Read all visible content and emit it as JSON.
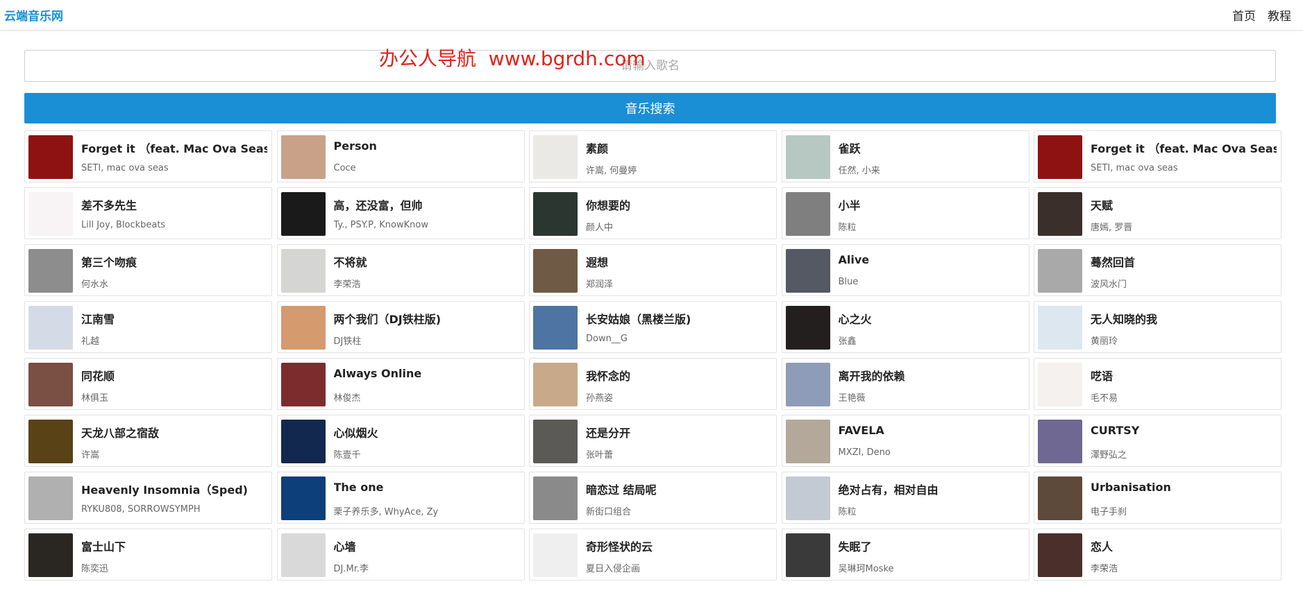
{
  "brand": "云端音乐网",
  "nav": [
    {
      "label": "首页"
    },
    {
      "label": "教程"
    }
  ],
  "search": {
    "placeholder": "请输入歌名",
    "watermark": "办公人导航  www.bgrdh.com",
    "button_label": "音乐搜索"
  },
  "songs": [
    {
      "title": "Forget it （feat. Mac Ova Seas)",
      "artist": "SETI, mac ova seas",
      "cover": "#8f1212"
    },
    {
      "title": "Person",
      "artist": "Coce",
      "cover": "#c9a189"
    },
    {
      "title": "素颜",
      "artist": "许嵩, 何曼婷",
      "cover": "#ebe9e6"
    },
    {
      "title": "雀跃",
      "artist": "任然, 小来",
      "cover": "#b7c8c2"
    },
    {
      "title": "Forget it （feat. Mac Ova Seas)",
      "artist": "SETI, mac ova seas",
      "cover": "#8f1212"
    },
    {
      "title": "差不多先生",
      "artist": "Lill Joy, Blockbeats",
      "cover": "#f8f4f5"
    },
    {
      "title": "高，还没富，但帅",
      "artist": "Ty., PSY.P, KnowKnow",
      "cover": "#1a1a1a"
    },
    {
      "title": "你想要的",
      "artist": "颜人中",
      "cover": "#2b3630"
    },
    {
      "title": "小半",
      "artist": "陈粒",
      "cover": "#7f7f7f"
    },
    {
      "title": "天赋",
      "artist": "唐嫣, 罗晋",
      "cover": "#3b2f2b"
    },
    {
      "title": "第三个吻痕",
      "artist": "何水水",
      "cover": "#8d8d8d"
    },
    {
      "title": "不将就",
      "artist": "李荣浩",
      "cover": "#d5d6d3"
    },
    {
      "title": "遐想",
      "artist": "郑润泽",
      "cover": "#6e5a45"
    },
    {
      "title": "Alive",
      "artist": "Blue",
      "cover": "#545963"
    },
    {
      "title": "蓦然回首",
      "artist": "波风水门",
      "cover": "#a9a9a9"
    },
    {
      "title": "江南雪",
      "artist": "礼越",
      "cover": "#d5dbe6"
    },
    {
      "title": "两个我们（DJ铁柱版)",
      "artist": "DJ铁柱",
      "cover": "#d59a6e"
    },
    {
      "title": "长安姑娘（黑楼兰版)",
      "artist": "Down__G",
      "cover": "#4d74a3"
    },
    {
      "title": "心之火",
      "artist": "张鑫",
      "cover": "#231f1e"
    },
    {
      "title": "无人知晓的我",
      "artist": "黄丽玲",
      "cover": "#dce7ef"
    },
    {
      "title": "同花顺",
      "artist": "林俱玉",
      "cover": "#7a4f44"
    },
    {
      "title": "Always Online",
      "artist": "林俊杰",
      "cover": "#7c2c2c"
    },
    {
      "title": "我怀念的",
      "artist": "孙燕姿",
      "cover": "#c8a98a"
    },
    {
      "title": "离开我的依赖",
      "artist": "王艳薇",
      "cover": "#8e9cb7"
    },
    {
      "title": "呓语",
      "artist": "毛不易",
      "cover": "#f4f1ee"
    },
    {
      "title": "天龙八部之宿敌",
      "artist": "许嵩",
      "cover": "#5a4217"
    },
    {
      "title": "心似烟火",
      "artist": "陈壹千",
      "cover": "#12284f"
    },
    {
      "title": "还是分开",
      "artist": "张叶蕾",
      "cover": "#5c5a56"
    },
    {
      "title": "FAVELA",
      "artist": "MXZI, Deno",
      "cover": "#b3a89a"
    },
    {
      "title": "CURTSY",
      "artist": "澤野弘之",
      "cover": "#6e6892"
    },
    {
      "title": "Heavenly Insomnia（Sped)",
      "artist": "RYKU808, SORROWSYMPH",
      "cover": "#b0b0b0"
    },
    {
      "title": "The one",
      "artist": "栗子养乐多, WhyAce, Zy",
      "cover": "#0d3f7a"
    },
    {
      "title": "暗恋过 结局呢",
      "artist": "新街口组合",
      "cover": "#8a8a8a"
    },
    {
      "title": "绝对占有，相对自由",
      "artist": "陈粒",
      "cover": "#c3cad4"
    },
    {
      "title": "Urbanisation",
      "artist": "电子手刹",
      "cover": "#5e4a3a"
    },
    {
      "title": "富士山下",
      "artist": "陈奕迅",
      "cover": "#2a2622"
    },
    {
      "title": "心墙",
      "artist": "DJ.Mr.李",
      "cover": "#d9d9d9"
    },
    {
      "title": "奇形怪状的云",
      "artist": "夏日入侵企画",
      "cover": "#efefef"
    },
    {
      "title": "失眠了",
      "artist": "吴琳珂Moske",
      "cover": "#3a3a3a"
    },
    {
      "title": "恋人",
      "artist": "李荣浩",
      "cover": "#4a2f2a"
    }
  ]
}
